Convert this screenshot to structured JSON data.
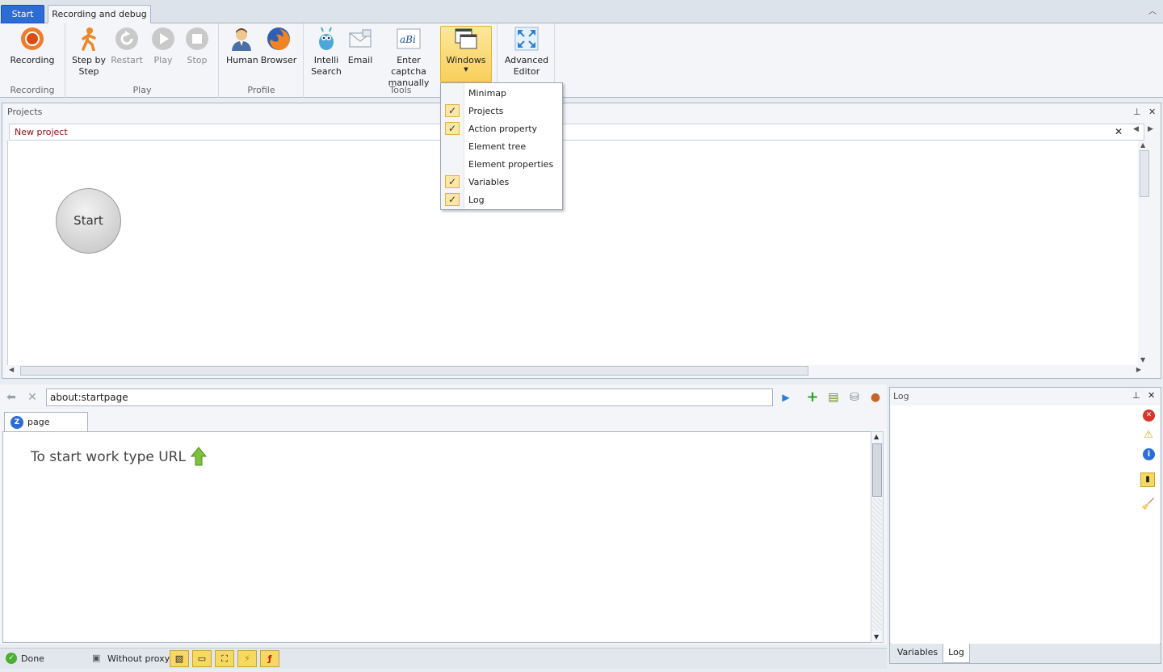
{
  "ribbon_tabs": {
    "start": "Start",
    "recording_debug": "Recording and debug"
  },
  "ribbon": {
    "recording_group": {
      "label": "Recording",
      "recording_btn": "Recording"
    },
    "play_group": {
      "label": "Play",
      "step1": "Step by",
      "step2": "Step",
      "restart": "Restart",
      "play": "Play",
      "stop": "Stop"
    },
    "profile_group": {
      "label": "Profile",
      "human": "Human",
      "browser": "Browser"
    },
    "tools_group": {
      "label": "Tools",
      "intelli1": "Intelli",
      "intelli2": "Search",
      "email": "Email",
      "captcha1": "Enter captcha",
      "captcha2": "manually",
      "windows": "Windows"
    },
    "advanced": {
      "line1": "Advanced",
      "line2": "Editor"
    }
  },
  "windows_menu": {
    "items": [
      {
        "label": "Minimap",
        "checked": false
      },
      {
        "label": "Projects",
        "checked": true
      },
      {
        "label": "Action property",
        "checked": true
      },
      {
        "label": "Element tree",
        "checked": false
      },
      {
        "label": "Element properties",
        "checked": false
      },
      {
        "label": "Variables",
        "checked": true
      },
      {
        "label": "Log",
        "checked": true
      }
    ]
  },
  "projects": {
    "title": "Projects",
    "doc_tab": "New project",
    "start_node": "Start"
  },
  "browser": {
    "url": "about:startpage",
    "page_tab": "page",
    "hint": "To start work type URL"
  },
  "log": {
    "title": "Log",
    "tabs": [
      "Variables",
      "Log"
    ]
  },
  "status": {
    "state": "Done",
    "proxy": "Without proxy"
  }
}
